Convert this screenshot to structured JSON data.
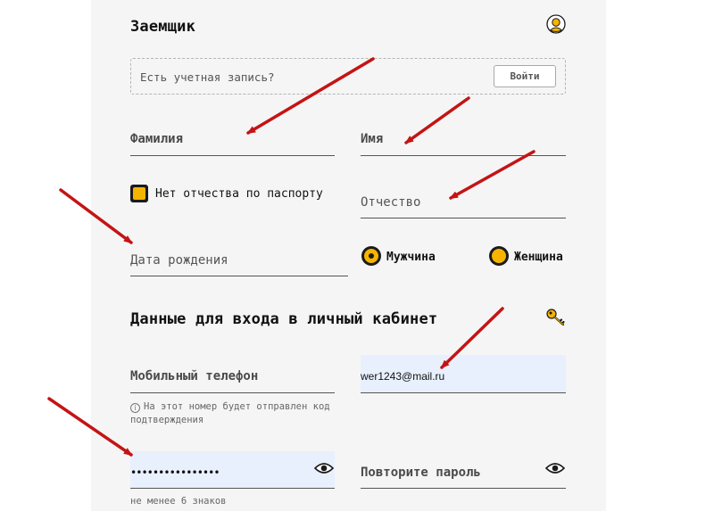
{
  "borrower": {
    "title": "Заемщик",
    "login_prompt": "Есть учетная запись?",
    "login_button": "Войти",
    "last_name_label": "Фамилия",
    "first_name_label": "Имя",
    "no_patronymic_label": "Нет отчества по паспорту",
    "patronymic_label": "Отчество",
    "birth_date_label": "Дата рождения",
    "gender_male": "Мужчина",
    "gender_female": "Женщина"
  },
  "account": {
    "title": "Данные для входа в личный кабинет",
    "phone_label": "Мобильный телефон",
    "phone_hint_line1": "На этот номер будет отправлен код",
    "phone_hint_line2": "подтверждения",
    "email_value": "wer1243@mail.ru",
    "password_value": "••••••••••••••••",
    "password_hint": "не менее 6 знаков",
    "repeat_password_label": "Повторите пароль"
  },
  "colors": {
    "accent": "#f5b400",
    "panel_bg": "#f5f5f5",
    "autofill_bg": "#e8f0fe",
    "annotation_arrow": "#c41414"
  },
  "icons": {
    "profile": "user-silhouette-icon",
    "key": "key-icon",
    "show_password": "eye-icon",
    "info": "info-icon"
  },
  "form_state": {
    "no_patronymic_checked": true,
    "gender_selected": "Мужчина"
  }
}
